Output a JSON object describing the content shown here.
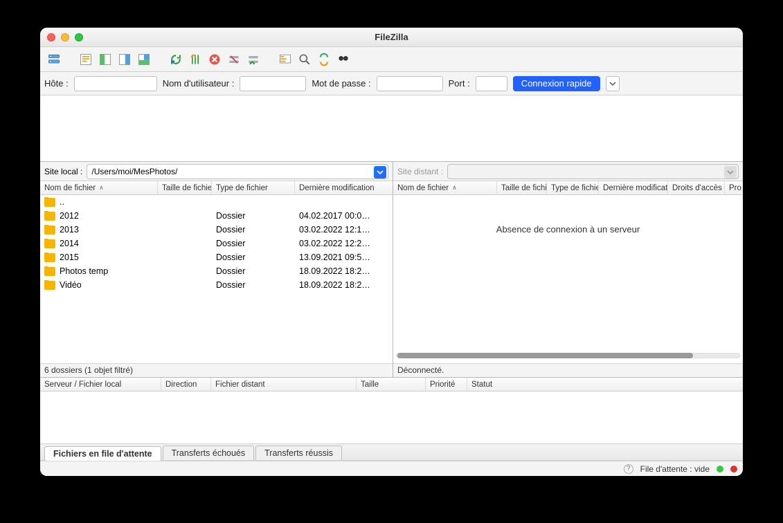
{
  "window": {
    "title": "FileZilla"
  },
  "quick": {
    "host_label": "Hôte :",
    "host_value": "",
    "user_label": "Nom d'utilisateur :",
    "user_value": "",
    "pass_label": "Mot de passe :",
    "pass_value": "",
    "port_label": "Port :",
    "port_value": "",
    "connect_label": "Connexion rapide"
  },
  "local": {
    "site_label": "Site local :",
    "path": "/Users/moi/MesPhotos/",
    "cols": [
      "Nom de fichier",
      "Taille de fichier",
      "Type de fichier",
      "Dernière modification"
    ],
    "rows": [
      {
        "name": "..",
        "size": "",
        "type": "",
        "modified": ""
      },
      {
        "name": "2012",
        "size": "",
        "type": "Dossier",
        "modified": "04.02.2017 00:0…"
      },
      {
        "name": "2013",
        "size": "",
        "type": "Dossier",
        "modified": "03.02.2022 12:1…"
      },
      {
        "name": "2014",
        "size": "",
        "type": "Dossier",
        "modified": "03.02.2022 12:2…"
      },
      {
        "name": "2015",
        "size": "",
        "type": "Dossier",
        "modified": "13.09.2021 09:5…"
      },
      {
        "name": "Photos temp",
        "size": "",
        "type": "Dossier",
        "modified": "18.09.2022 18:2…"
      },
      {
        "name": "Vidéo",
        "size": "",
        "type": "Dossier",
        "modified": "18.09.2022 18:2…"
      }
    ],
    "status": "6 dossiers (1 objet filtré)"
  },
  "remote": {
    "site_label": "Site distant :",
    "cols": [
      "Nom de fichier",
      "Taille de fichi",
      "Type de fichier",
      "Dernière modificat",
      "Droits d'accès",
      "Pro"
    ],
    "empty_msg": "Absence de connexion à un serveur",
    "status": "Déconnecté."
  },
  "queue": {
    "cols": [
      "Serveur / Fichier local",
      "Direction",
      "Fichier distant",
      "Taille",
      "Priorité",
      "Statut"
    ]
  },
  "tabs": [
    "Fichiers en file d'attente",
    "Transferts échoués",
    "Transferts réussis"
  ],
  "bottom": {
    "queue_text": "File d'attente : vide"
  }
}
